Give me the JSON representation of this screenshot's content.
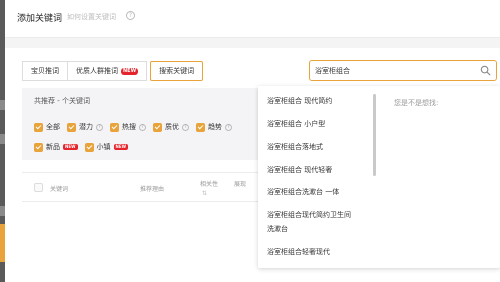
{
  "header": {
    "title": "添加关键词",
    "howto_link": "如何设置关键词"
  },
  "tabs": [
    {
      "label": "宝贝推词"
    },
    {
      "label": "优质人群推词",
      "badge": "NEW"
    },
    {
      "label": "搜索关键词"
    }
  ],
  "search": {
    "value": "浴室柜组合"
  },
  "recommend": {
    "title": "共推荐 - 个关键词",
    "filters_row1": [
      {
        "label": "全部"
      },
      {
        "label": "潜力"
      },
      {
        "label": "热搜"
      },
      {
        "label": "质优"
      },
      {
        "label": "趋势"
      }
    ],
    "filters_row2": [
      {
        "label": "新品",
        "badge": "NEW"
      },
      {
        "label": "小镇",
        "badge": "NEW"
      }
    ]
  },
  "table": {
    "col_keyword": "关键词",
    "col_reason": "推荐理由",
    "col_relevance": "相关性",
    "col_show": "展现"
  },
  "dropdown": {
    "items": [
      "浴室柜组合 现代简约",
      "浴室柜组合 小户型",
      "浴室柜组合落地式",
      "浴室柜组合 现代轻奢",
      "浴室柜组合洗漱台 一体",
      "浴室柜组合现代简约卫生间",
      "洗漱台",
      "浴室柜组合轻奢现代"
    ],
    "suggest_title": "您是不是想找:"
  }
}
